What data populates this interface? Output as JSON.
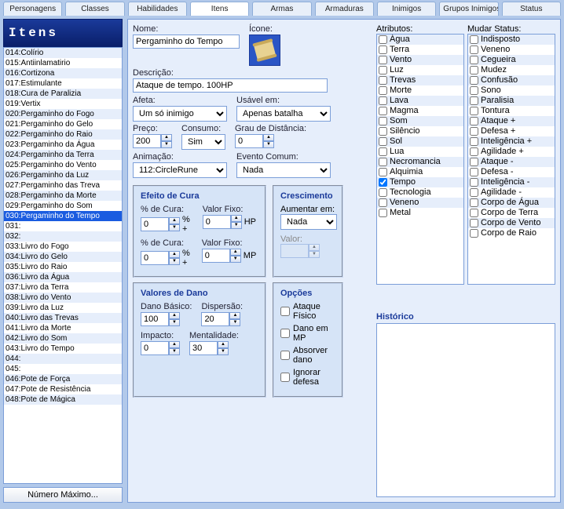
{
  "tabs": [
    "Personagens",
    "Classes",
    "Habilidades",
    "Itens",
    "Armas",
    "Armaduras",
    "Inimigos",
    "Grupos Inimigos",
    "Status"
  ],
  "active_tab": 3,
  "sidebar": {
    "title": "Itens",
    "items": [
      "014:Colírio",
      "015:Antiinlamatirio",
      "016:Cortizona",
      "017:Estimulante",
      "018:Cura de Paralizia",
      "019:Vertix",
      "020:Pergaminho do Fogo",
      "021:Pergaminho do Gelo",
      "022:Pergaminho do Raio",
      "023:Pergaminho da Água",
      "024:Pergaminho da Terra",
      "025:Pergaminho do Vento",
      "026:Pergaminho da Luz",
      "027:Pergaminho das Treva",
      "028:Pergaminho da Morte",
      "029:Pergaminho do Som",
      "030:Pergaminho do Tempo",
      "031:",
      "032:",
      "033:Livro do Fogo",
      "034:Livro do Gelo",
      "035:Livro do Raio",
      "036:Livro da Água",
      "037:Livro da Terra",
      "038:Livro do Vento",
      "039:Livro da Luz",
      "040:Livro das Trevas",
      "041:Livro da Morte",
      "042:Livro do Som",
      "043:Livro do Tempo",
      "044:",
      "045:",
      "046:Pote de Força",
      "047:Pote de Resistência",
      "048:Pote de Mágica"
    ],
    "selected_index": 16,
    "max_button": "Número Máximo..."
  },
  "form": {
    "nome_label": "Nome:",
    "nome": "Pergaminho do Tempo",
    "icone_label": "Ícone:",
    "descricao_label": "Descrição:",
    "descricao": "Ataque de tempo. 100HP",
    "afeta_label": "Afeta:",
    "afeta": "Um só inimigo",
    "usavel_label": "Usável em:",
    "usavel": "Apenas batalha",
    "preco_label": "Preço:",
    "preco": "200",
    "consumo_label": "Consumo:",
    "consumo": "Sim",
    "grau_label": "Grau de Distância:",
    "grau": "0",
    "animacao_label": "Animação:",
    "animacao": "112:CircleRune",
    "evento_label": "Evento Comum:",
    "evento": "Nada"
  },
  "cura": {
    "title": "Efeito de Cura",
    "pct_label": "% de Cura:",
    "fixo_label": "Valor Fixo:",
    "pct1": "0",
    "fixo1": "0",
    "suffix1": "HP",
    "pct2": "0",
    "fixo2": "0",
    "suffix2": "MP",
    "joiner": "% +"
  },
  "cresc": {
    "title": "Crescimento",
    "aumentar_label": "Aumentar em:",
    "aumentar": "Nada",
    "valor_label": "Valor:",
    "valor": ""
  },
  "dano": {
    "title": "Valores de Dano",
    "basico_label": "Dano Básico:",
    "basico": "100",
    "dispersao_label": "Dispersão:",
    "dispersao": "20",
    "impacto_label": "Impacto:",
    "impacto": "0",
    "mentalidade_label": "Mentalidade:",
    "mentalidade": "30"
  },
  "opcoes": {
    "title": "Opções",
    "items": [
      "Ataque Físico",
      "Dano em MP",
      "Absorver dano",
      "Ignorar defesa"
    ]
  },
  "atributos": {
    "label": "Atributos:",
    "items": [
      {
        "label": "Água",
        "checked": false
      },
      {
        "label": "Terra",
        "checked": false
      },
      {
        "label": "Vento",
        "checked": false
      },
      {
        "label": "Luz",
        "checked": false
      },
      {
        "label": "Trevas",
        "checked": false
      },
      {
        "label": "Morte",
        "checked": false
      },
      {
        "label": "Lava",
        "checked": false
      },
      {
        "label": "Magma",
        "checked": false
      },
      {
        "label": "Som",
        "checked": false
      },
      {
        "label": "Silêncio",
        "checked": false
      },
      {
        "label": "Sol",
        "checked": false
      },
      {
        "label": "Lua",
        "checked": false
      },
      {
        "label": "Necromancia",
        "checked": false
      },
      {
        "label": "Alquimia",
        "checked": false
      },
      {
        "label": "Tempo",
        "checked": true
      },
      {
        "label": "Tecnologia",
        "checked": false
      },
      {
        "label": "Veneno",
        "checked": false
      },
      {
        "label": "Metal",
        "checked": false
      }
    ]
  },
  "mudar_status": {
    "label": "Mudar Status:",
    "items": [
      "Indisposto",
      "Veneno",
      "Cegueira",
      "Mudez",
      "Confusão",
      "Sono",
      "Paralisia",
      "Tontura",
      "Ataque +",
      "Defesa +",
      "Inteligência +",
      "Agilidade +",
      "Ataque -",
      "Defesa -",
      "Inteligência -",
      "Agilidade -",
      "Corpo de Água",
      "Corpo de Terra",
      "Corpo de Vento",
      "Corpo de Raio"
    ]
  },
  "historico_label": "Histórico"
}
